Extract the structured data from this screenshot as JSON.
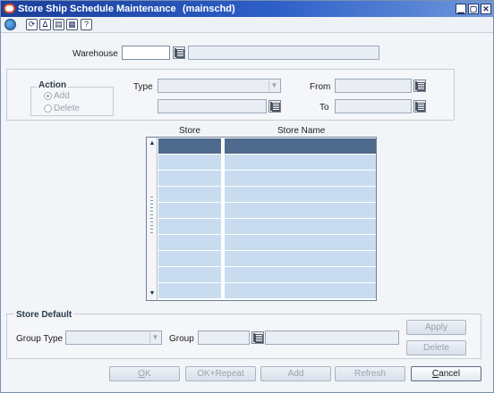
{
  "titlebar": {
    "title": "Store Ship Schedule Maintenance",
    "subtitle": "(mainschd)",
    "controls": {
      "minimize": "▁",
      "restore": "▢",
      "close": "✕"
    }
  },
  "toolbar": {
    "icons": [
      "globe-icon",
      "refresh-icon",
      "filter-icon",
      "save-icon",
      "print-icon",
      "help-icon"
    ],
    "glyphs": [
      "",
      "⟳",
      "ᐃ",
      "▤",
      "▦",
      "?"
    ]
  },
  "warehouse": {
    "label": "Warehouse",
    "code": "",
    "description": ""
  },
  "action": {
    "label": "Action",
    "options": [
      {
        "label": "Add",
        "checked": true
      },
      {
        "label": "Delete",
        "checked": false
      }
    ]
  },
  "type": {
    "label": "Type",
    "value": ""
  },
  "from": {
    "label": "From",
    "value": ""
  },
  "to": {
    "label": "To",
    "value": ""
  },
  "grid": {
    "columns": [
      "Store",
      "Store Name"
    ],
    "selected_row": 0,
    "scroll_up": "▲",
    "scroll_down": "▼"
  },
  "store_default": {
    "label": "Store Default",
    "group_type_label": "Group Type",
    "group_label": "Group",
    "apply_label": "Apply",
    "delete_label": "Delete"
  },
  "footer": {
    "ok": {
      "mnemonic": "O",
      "rest": "K"
    },
    "ok_repeat": "OK+Repeat",
    "add": "Add",
    "refresh": "Refresh",
    "cancel": {
      "mnemonic": "C",
      "rest": "ancel"
    }
  },
  "colors": {
    "title_gradient_start": "#1a3f9a",
    "selected_row": "#4e6a8c",
    "row": "#c9dcef"
  }
}
